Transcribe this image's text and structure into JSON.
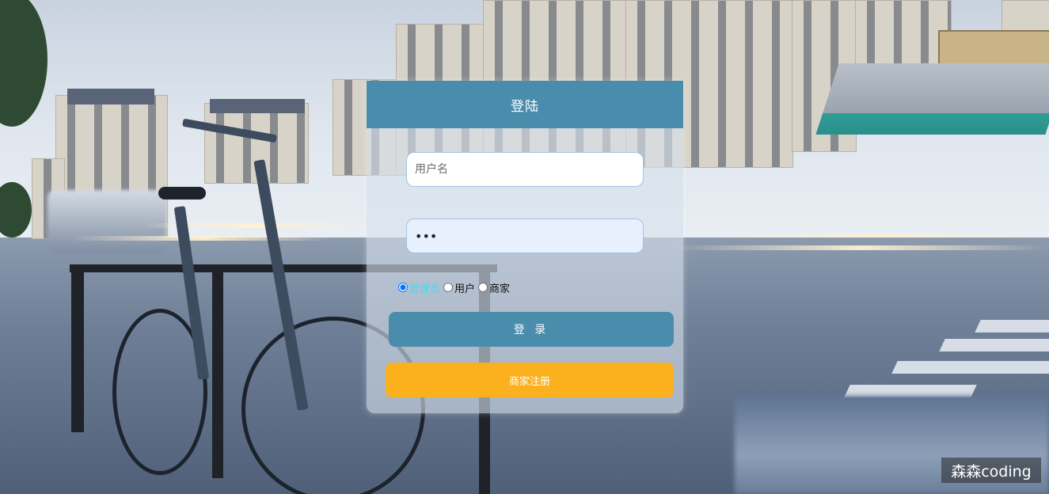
{
  "login": {
    "title": "登陆",
    "username_placeholder": "用户名",
    "password_value": "•••",
    "roles": [
      {
        "label": "管理员",
        "selected": true
      },
      {
        "label": "用户",
        "selected": false
      },
      {
        "label": "商家",
        "selected": false
      }
    ],
    "login_button": "登 录",
    "register_button": "商家注册"
  },
  "watermark": "森森coding",
  "colors": {
    "header": "#4a8cab",
    "login_button": "#4a8cab",
    "register_button": "#fbb11e",
    "active_role_text": "#4fd6f0"
  }
}
